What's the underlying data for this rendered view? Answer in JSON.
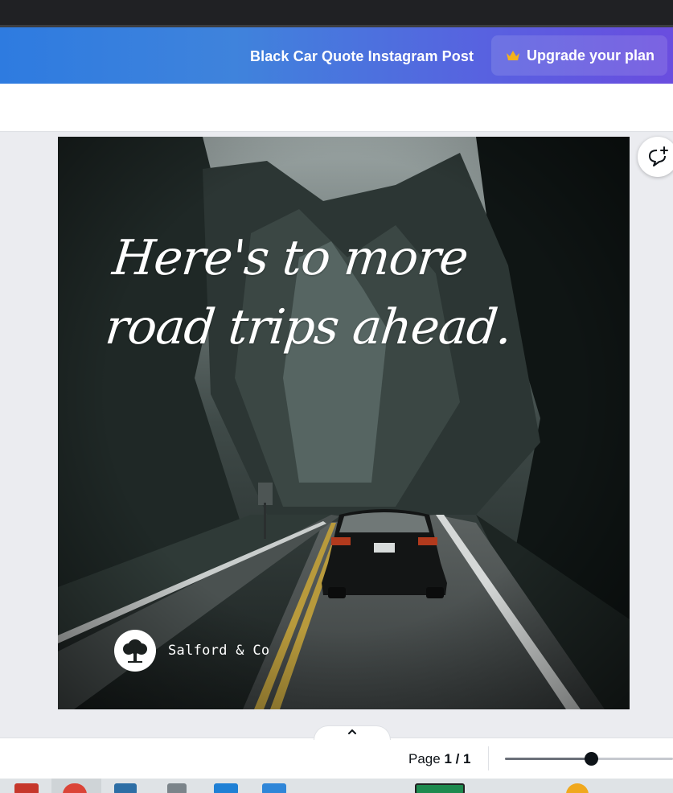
{
  "header": {
    "doc_title": "Black Car Quote Instagram Post",
    "upgrade_label": "Upgrade your plan",
    "upgrade_icon": "crown-icon",
    "colors": {
      "gradient_start": "#2e7be0",
      "gradient_end": "#6a4ddf",
      "crown": "#f5b21b"
    }
  },
  "design": {
    "quote_line1": "Here's to more",
    "quote_line2": "road trips ahead.",
    "brand_name": "Salford & Co",
    "brand_logo_icon": "tree-icon"
  },
  "side_actions": {
    "comment_icon": "comment-add-icon"
  },
  "footer": {
    "collapse_icon": "chevron-up-icon",
    "page_label": "Page",
    "page_value": "1 / 1",
    "zoom_level_fraction": 0.51
  },
  "taskbar": {
    "icons": [
      "app-icon",
      "chrome-icon",
      "app-icon",
      "app-icon",
      "vscode-icon",
      "app-icon",
      "app-icon",
      "app-icon"
    ]
  }
}
